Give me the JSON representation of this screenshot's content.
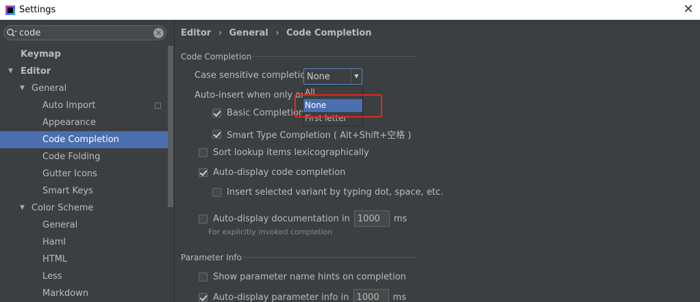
{
  "window": {
    "title": "Settings"
  },
  "search": {
    "value": "code"
  },
  "tree": [
    {
      "label": "Keymap",
      "level": 0,
      "bold": true,
      "arrow": ""
    },
    {
      "label": "Editor",
      "level": 0,
      "bold": true,
      "arrow": "▼"
    },
    {
      "label": "General",
      "level": 1,
      "arrow": "▼"
    },
    {
      "label": "Auto Import",
      "level": 2,
      "copy": true
    },
    {
      "label": "Appearance",
      "level": 2
    },
    {
      "label": "Code Completion",
      "level": 2,
      "selected": true
    },
    {
      "label": "Code Folding",
      "level": 2
    },
    {
      "label": "Gutter Icons",
      "level": 2
    },
    {
      "label": "Smart Keys",
      "level": 2
    },
    {
      "label": "Color Scheme",
      "level": 1,
      "arrow": "▼"
    },
    {
      "label": "General",
      "level": 2
    },
    {
      "label": "Haml",
      "level": 2
    },
    {
      "label": "HTML",
      "level": 2
    },
    {
      "label": "Less",
      "level": 2
    },
    {
      "label": "Markdown",
      "level": 2
    }
  ],
  "breadcrumb": {
    "a": "Editor",
    "b": "General",
    "c": "Code Completion",
    "sep": "›"
  },
  "code_completion": {
    "section": "Code Completion",
    "case_label": "Case sensitive completion:",
    "case_value": "None",
    "dropdown_options": [
      "All",
      "None",
      "First letter"
    ],
    "auto_insert_label": "Auto-insert when only one",
    "basic_label": "Basic Completion (",
    "basic_checked": true,
    "smart_label": "Smart Type Completion ( Alt+Shift+空格 )",
    "smart_checked": true,
    "sort_label": "Sort lookup items lexicographically",
    "sort_checked": false,
    "autodisplay_label": "Auto-display code completion",
    "autodisplay_checked": true,
    "insert_variant_label": "Insert selected variant by typing dot, space, etc.",
    "insert_variant_checked": false,
    "autodoc_label": "Auto-display documentation in",
    "autodoc_checked": false,
    "autodoc_value": "1000",
    "autodoc_unit": "ms",
    "autodoc_hint": "For explicitly invoked completion"
  },
  "parameter_info": {
    "section": "Parameter Info",
    "hints_label": "Show parameter name hints on completion",
    "hints_checked": false,
    "autodisplay_label": "Auto-display parameter info in",
    "autodisplay_checked": true,
    "autodisplay_value": "1000",
    "autodisplay_unit": "ms"
  },
  "colors": {
    "selection": "#4b6eaf",
    "highlight_box": "#e4281a",
    "background": "#3c3f41"
  }
}
